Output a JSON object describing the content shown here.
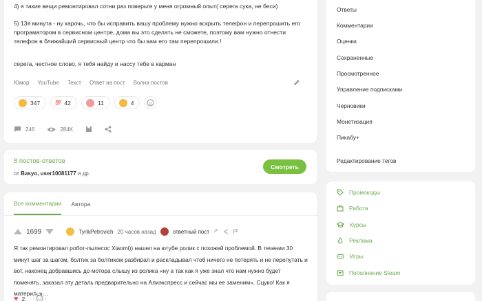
{
  "post": {
    "paragraphs": [
      "4) я такие вещи ремонтировал сотни раз поверьте у меня огромный опыт( серега сука, не беси)",
      "5) 13я минута - ну карочь, что бы исправить вашу проблему нужно вскрыть телефон и перепрошить его програматором в сервисном центре, дома вы это сделать не сможете, поэтому вам нужно отнести телефон в ближайший сервисный центр что бы вам его там перепрошили.!",
      "серега, честное слово, я тебя найду и нассу тебе в карман"
    ],
    "tags": [
      "Юмор",
      "YouTube",
      "Текст",
      "Ответ на пост",
      "Волна постов"
    ],
    "reactions": [
      {
        "icon": "laughing-emoji-icon",
        "count": "347"
      },
      {
        "icon": "hundred-emoji-icon",
        "count": "42"
      },
      {
        "icon": "clown-emoji-icon",
        "count": "11"
      },
      {
        "icon": "laughing-emoji-icon",
        "count": "4"
      }
    ],
    "comments_count": "246",
    "views_count": "284K"
  },
  "answers": {
    "title": "8 постов-ответов",
    "from_prefix": "от ",
    "from_names": "Basyo, user10081177",
    "from_suffix": " и др.",
    "watch_label": "Смотреть"
  },
  "comments": {
    "tabs": [
      "Все комментарии",
      "Автора"
    ],
    "first": {
      "score": "1699",
      "author": "TyrikPetrovich",
      "time": "20 часов назад",
      "reply_label": "ответный пост",
      "text": "Я так ремонтировал робот-пылесос Xiaomi)) нашел на ютубе ролик с похожей проблемой. В течении 30 минут шаг за шагом, болтик за болтиком разбирал и раскладывал чтоб ничего не потерять и не перепутать и вот, наконец добравшись до мотора слышу из ролика «ну а так как я уже знал что нам нужно будет поменять, заказал эту деталь предварительно на Алиэкспресс и сейчас мы ее заменим». Сцуко! Как я матерился…",
      "likes": "2"
    }
  },
  "sidebar": {
    "menu": [
      "Ответы",
      "Комментарии",
      "Оценки",
      "Сохраненные",
      "Просмотренное",
      "Управление подписками",
      "Черновики",
      "Монетизация",
      "Пикабу+",
      "Редактирование тегов"
    ],
    "links": [
      {
        "label": "Промокоды",
        "icon": "tag-icon"
      },
      {
        "label": "Работа",
        "icon": "briefcase-icon"
      },
      {
        "label": "Курсы",
        "icon": "graduation-cap-icon"
      },
      {
        "label": "Реклама",
        "icon": "fire-icon"
      },
      {
        "label": "Игры",
        "icon": "gamepad-icon"
      },
      {
        "label": "Пополнение Steam",
        "icon": "wallet-icon"
      }
    ]
  },
  "colors": {
    "accent": "#6aa84f",
    "button": "#7ac142",
    "background": "#f2f2f2"
  }
}
